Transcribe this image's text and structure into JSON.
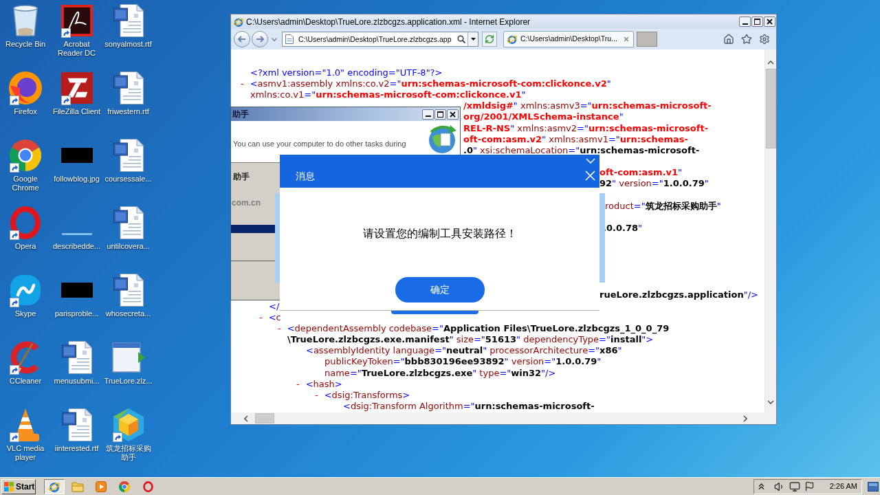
{
  "desktop": {
    "icons": [
      {
        "label": "Recycle Bin",
        "kind": "bin",
        "shortcut": false
      },
      {
        "label": "Firefox",
        "kind": "fox",
        "shortcut": true
      },
      {
        "label": "Google Chrome",
        "kind": "ring",
        "shortcut": true
      },
      {
        "label": "Opera",
        "kind": "o_ring",
        "shortcut": true
      },
      {
        "label": "Skype",
        "kind": "cloud",
        "shortcut": true
      },
      {
        "label": "CCleaner",
        "kind": "brush",
        "shortcut": true
      },
      {
        "label": "VLC media player",
        "kind": "cone",
        "shortcut": true
      },
      {
        "label": "Acrobat Reader DC",
        "kind": "swirl",
        "shortcut": true
      },
      {
        "label": "FileZilla Client",
        "kind": "tile",
        "shortcut": true
      },
      {
        "label": "followblog.jpg",
        "kind": "black_image",
        "shortcut": false
      },
      {
        "label": "describedde...",
        "kind": "blank_image",
        "shortcut": false
      },
      {
        "label": "parisproble...",
        "kind": "black_image",
        "shortcut": false
      },
      {
        "label": "menusubmi...",
        "kind": "document",
        "shortcut": false
      },
      {
        "label": "iinterested.rtf",
        "kind": "document",
        "shortcut": false
      },
      {
        "label": "sonyalmost.rtf",
        "kind": "document",
        "shortcut": false
      },
      {
        "label": "friwestern.rtf",
        "kind": "document",
        "shortcut": false
      },
      {
        "label": "coursessale...",
        "kind": "document",
        "shortcut": false
      },
      {
        "label": "untilcovera...",
        "kind": "document",
        "shortcut": false
      },
      {
        "label": "whosecreta...",
        "kind": "document",
        "shortcut": false
      },
      {
        "label": "TrueLore.zlz...",
        "kind": "app_window",
        "shortcut": false
      },
      {
        "label": "筑龙招标采购助手",
        "kind": "cube",
        "shortcut": true
      }
    ]
  },
  "browser": {
    "title": "C:\\Users\\admin\\Desktop\\TrueLore.zlzbcgzs.application.xml - Internet Explorer",
    "address": "C:\\Users\\admin\\Desktop\\TrueLore.zlzbcgzs.app",
    "tabs": [
      {
        "label": "C:\\Users\\admin\\Desktop\\Tru...",
        "selected": true
      }
    ],
    "xml": [
      {
        "lines": [
          [
            {
              "kind": "markup",
              "text": "<?xml version=\"1.0\" encoding=\"UTF-8\"?>"
            }
          ]
        ]
      },
      {
        "toggle": "-",
        "lines": [
          [
            {
              "kind": "markup",
              "text": "<"
            },
            {
              "kind": "name",
              "text": "asmv1:assembly xmlns:co.v2"
            },
            {
              "kind": "markup",
              "text": "=\""
            },
            {
              "kind": "ns",
              "text": "urn:schemas-microsoft-com:clickonce.v2"
            },
            {
              "kind": "markup",
              "text": "\""
            }
          ],
          [
            {
              "kind": "name",
              "text": "xmlns:co.v1"
            },
            {
              "kind": "markup",
              "text": "=\""
            },
            {
              "kind": "ns",
              "text": "urn:schemas-microsoft-com:clickonce.v1"
            },
            {
              "kind": "markup",
              "text": "\""
            }
          ],
          [
            {
              "kind": "ns",
              "text": "/xmldsig#"
            },
            {
              "kind": "markup",
              "text": "\""
            },
            {
              "kind": "name",
              "text": " xmlns:asmv3"
            },
            {
              "kind": "markup",
              "text": "=\""
            },
            {
              "kind": "ns",
              "text": "urn:schemas-microsoft-"
            }
          ],
          [
            {
              "kind": "ns",
              "text": "org/2001/XMLSchema-instance"
            },
            {
              "kind": "markup",
              "text": "\""
            }
          ],
          [
            {
              "kind": "ns",
              "text": "REL-R-NS"
            },
            {
              "kind": "markup",
              "text": "\""
            },
            {
              "kind": "name",
              "text": " xmlns:asmv2"
            },
            {
              "kind": "markup",
              "text": "=\""
            },
            {
              "kind": "ns",
              "text": "urn:schemas-microsoft-"
            }
          ],
          [
            {
              "kind": "ns",
              "text": "oft-com:asm.v2"
            },
            {
              "kind": "markup",
              "text": "\""
            },
            {
              "kind": "name",
              "text": " xmlns:asmv1"
            },
            {
              "kind": "markup",
              "text": "=\""
            },
            {
              "kind": "ns",
              "text": "urn:schemas-"
            }
          ],
          [
            {
              "kind": "value",
              "text": ".0"
            },
            {
              "kind": "markup",
              "text": "\""
            },
            {
              "kind": "name",
              "text": " xsi:schemaLocation"
            },
            {
              "kind": "markup",
              "text": "=\""
            },
            {
              "kind": "value",
              "text": "urn:schemas-microsoft-"
            }
          ],
          [
            {
              "kind": "ns",
              "text": "oft-com:asm.v1"
            },
            {
              "kind": "markup",
              "text": "\""
            }
          ]
        ],
        "children": [
          {
            "lines": [
              [
                {
                  "kind": "value",
                  "text": "92"
                },
                {
                  "kind": "markup",
                  "text": "\""
                },
                {
                  "kind": "name",
                  "text": " version"
                },
                {
                  "kind": "markup",
                  "text": "=\""
                },
                {
                  "kind": "value",
                  "text": "1.0.0.79"
                },
                {
                  "kind": "markup",
                  "text": "\""
                }
              ]
            ]
          },
          {
            "lines": [
              [
                {
                  "kind": "name",
                  "text": "roduct"
                },
                {
                  "kind": "markup",
                  "text": "=\""
                },
                {
                  "kind": "value",
                  "text": "筑龙招标采购助手"
                },
                {
                  "kind": "markup",
                  "text": "\""
                }
              ]
            ]
          },
          {
            "lines": [
              [
                {
                  "kind": "value",
                  "text": ".0.0.78"
                },
                {
                  "kind": "markup",
                  "text": "\""
                }
              ]
            ]
          },
          {
            "lines": [
              [
                {
                  "kind": "value",
                  "text": "rueLore.zlzbcgzs.application"
                },
                {
                  "kind": "markup",
                  "text": "\"/>"
                }
              ]
            ]
          },
          {
            "lines": [
              [
                {
                  "kind": "markup",
                  "text": "</"
                }
              ]
            ]
          },
          {
            "toggle": "-",
            "lines": [
              [
                {
                  "kind": "markup",
                  "text": "<"
                },
                {
                  "kind": "name",
                  "text": "c"
                }
              ]
            ],
            "children": [
              {
                "toggle": "-",
                "lines": [
                  [
                    {
                      "kind": "markup",
                      "text": "<"
                    },
                    {
                      "kind": "name",
                      "text": "dependentAssembly codebase"
                    },
                    {
                      "kind": "markup",
                      "text": "=\""
                    },
                    {
                      "kind": "value",
                      "text": "Application Files\\TrueLore.zlzbcgzs_1_0_0_79"
                    }
                  ],
                  [
                    {
                      "kind": "value",
                      "text": "\\TrueLore.zlzbcgzs.exe.manifest"
                    },
                    {
                      "kind": "markup",
                      "text": "\""
                    },
                    {
                      "kind": "name",
                      "text": " size"
                    },
                    {
                      "kind": "markup",
                      "text": "=\""
                    },
                    {
                      "kind": "value",
                      "text": "51613"
                    },
                    {
                      "kind": "markup",
                      "text": "\""
                    },
                    {
                      "kind": "name",
                      "text": " dependencyType"
                    },
                    {
                      "kind": "markup",
                      "text": "=\""
                    },
                    {
                      "kind": "value",
                      "text": "install"
                    },
                    {
                      "kind": "markup",
                      "text": "\">"
                    }
                  ]
                ],
                "children": [
                  {
                    "lines": [
                      [
                        {
                          "kind": "markup",
                          "text": "<"
                        },
                        {
                          "kind": "name",
                          "text": "assemblyIdentity language"
                        },
                        {
                          "kind": "markup",
                          "text": "=\""
                        },
                        {
                          "kind": "value",
                          "text": "neutral"
                        },
                        {
                          "kind": "markup",
                          "text": "\""
                        },
                        {
                          "kind": "name",
                          "text": " processorArchitecture"
                        },
                        {
                          "kind": "markup",
                          "text": "=\""
                        },
                        {
                          "kind": "value",
                          "text": "x86"
                        },
                        {
                          "kind": "markup",
                          "text": "\""
                        }
                      ],
                      [
                        {
                          "kind": "name",
                          "text": "publicKeyToken"
                        },
                        {
                          "kind": "markup",
                          "text": "=\""
                        },
                        {
                          "kind": "value",
                          "text": "bbb830196ee93892"
                        },
                        {
                          "kind": "markup",
                          "text": "\""
                        },
                        {
                          "kind": "name",
                          "text": " version"
                        },
                        {
                          "kind": "markup",
                          "text": "=\""
                        },
                        {
                          "kind": "value",
                          "text": "1.0.0.79"
                        },
                        {
                          "kind": "markup",
                          "text": "\""
                        }
                      ],
                      [
                        {
                          "kind": "name",
                          "text": "name"
                        },
                        {
                          "kind": "markup",
                          "text": "=\""
                        },
                        {
                          "kind": "value",
                          "text": "TrueLore.zlzbcgzs.exe"
                        },
                        {
                          "kind": "markup",
                          "text": "\""
                        },
                        {
                          "kind": "name",
                          "text": " type"
                        },
                        {
                          "kind": "markup",
                          "text": "=\""
                        },
                        {
                          "kind": "value",
                          "text": "win32"
                        },
                        {
                          "kind": "markup",
                          "text": "\"/>"
                        }
                      ]
                    ]
                  },
                  {
                    "toggle": "-",
                    "lines": [
                      [
                        {
                          "kind": "markup",
                          "text": "<"
                        },
                        {
                          "kind": "name",
                          "text": "hash"
                        },
                        {
                          "kind": "markup",
                          "text": ">"
                        }
                      ]
                    ],
                    "children": [
                      {
                        "toggle": "-",
                        "lines": [
                          [
                            {
                              "kind": "markup",
                              "text": "<"
                            },
                            {
                              "kind": "name",
                              "text": "dsig:Transforms"
                            },
                            {
                              "kind": "markup",
                              "text": ">"
                            }
                          ]
                        ],
                        "children": [
                          {
                            "lines": [
                              [
                                {
                                  "kind": "markup",
                                  "text": "<"
                                },
                                {
                                  "kind": "name",
                                  "text": "dsig:Transform Algorithm"
                                },
                                {
                                  "kind": "markup",
                                  "text": "=\""
                                },
                                {
                                  "kind": "value",
                                  "text": "urn:schemas-microsoft-"
                                }
                              ]
                            ]
                          }
                        ]
                      }
                    ]
                  }
                ]
              }
            ]
          }
        ]
      }
    ]
  },
  "installer": {
    "title": "助手",
    "description": "You can use your computer to do other tasks during",
    "product": "助手",
    "site": "com.cn"
  },
  "message_dialog": {
    "title": "消息",
    "message": "请设置您的编制工具安装路径！",
    "button": "确定"
  },
  "taskbar": {
    "start": "Start",
    "apps": [
      {
        "kind": "browser",
        "active": true
      },
      {
        "kind": "folder",
        "active": false
      },
      {
        "kind": "player",
        "active": false
      },
      {
        "kind": "ring",
        "active": false
      },
      {
        "kind": "o_ring",
        "active": false
      }
    ],
    "clock": "2:26 AM"
  }
}
